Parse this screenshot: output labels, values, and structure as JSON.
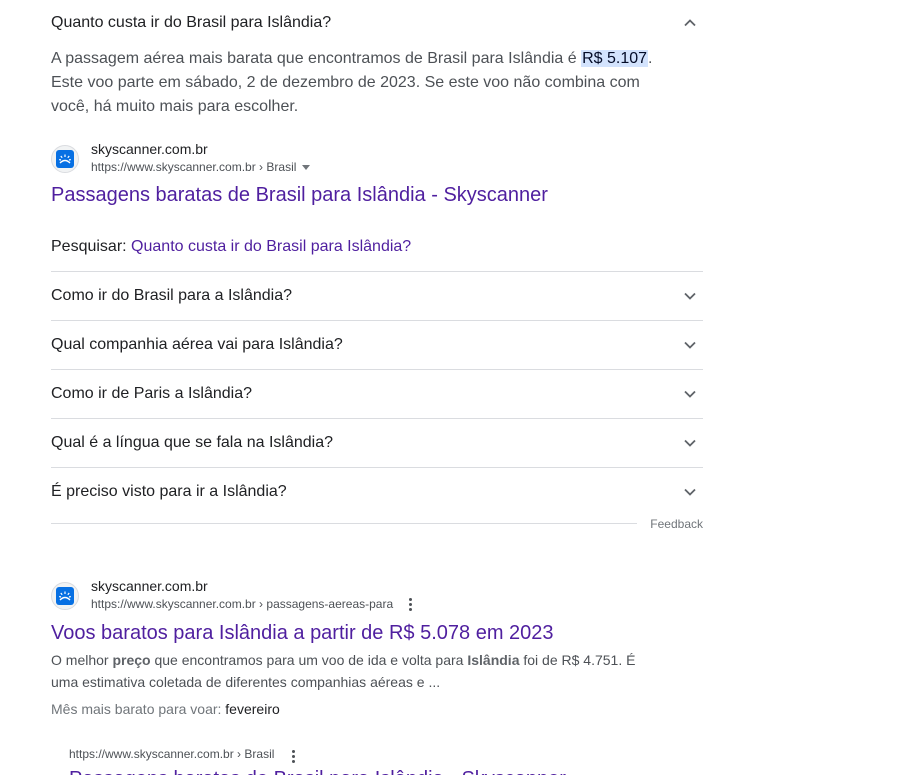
{
  "expanded_question": {
    "question": "Quanto custa ir do Brasil para Islândia?",
    "answer_before": "A passagem aérea mais barata que encontramos de Brasil para Islândia é ",
    "answer_price": "R$ 5.107",
    "answer_after": ". Este voo parte em sábado, 2 de dezembro de 2023. Se este voo não combina com você, há muito mais para escolher."
  },
  "source_1": {
    "site_name": "skyscanner.com.br",
    "url": "https://www.skyscanner.com.br › Brasil",
    "title": "Passagens baratas de Brasil para Islândia - Skyscanner"
  },
  "pesquisar": {
    "label": "Pesquisar:",
    "link": "Quanto custa ir do Brasil para Islândia?"
  },
  "related_questions": [
    "Como ir do Brasil para a Islândia?",
    "Qual companhia aérea vai para Islândia?",
    "Como ir de Paris a Islândia?",
    "Qual é a língua que se fala na Islândia?",
    "É preciso visto para ir a Islândia?"
  ],
  "feedback_label": "Feedback",
  "result_2": {
    "site_name": "skyscanner.com.br",
    "url": "https://www.skyscanner.com.br › passagens-aereas-para",
    "title": "Voos baratos para Islândia a partir de R$ 5.078 em 2023",
    "snippet_1": "O melhor ",
    "snippet_b1": "preço",
    "snippet_2": " que encontramos para um voo de ida e volta para ",
    "snippet_b2": "Islândia",
    "snippet_3": " foi de R$ 4.751. É uma estimativa coletada de diferentes companhias aéreas e ...",
    "mes_label": "Mês mais barato para voar: ",
    "mes_value": "fevereiro"
  },
  "sub_result": {
    "url": "https://www.skyscanner.com.br › Brasil",
    "title": "Passagens baratas de Brasil para Islândia - Skyscanner"
  },
  "colors": {
    "link_visited": "#4f1f9f",
    "highlight": "#d3e3fd",
    "favicon_blue": "#0770e3"
  },
  "icons": {
    "expanded": "chevron-up-icon",
    "collapsed": "chevron-down-icon",
    "more": "more-vert-icon",
    "favicon": "skyscanner-favicon"
  }
}
